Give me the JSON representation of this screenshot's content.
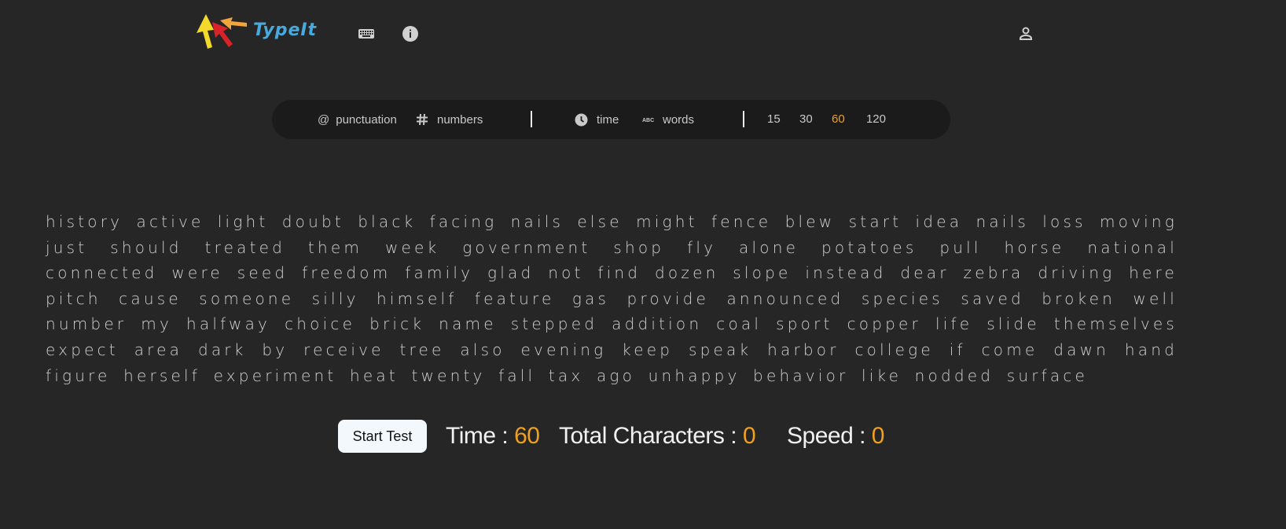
{
  "header": {
    "logo_text": "TypeIt",
    "icons": {
      "keyboard": "keyboard-icon",
      "info": "info-icon",
      "user": "user-icon"
    }
  },
  "config_bar": {
    "punctuation_symbol": "@",
    "punctuation_label": "punctuation",
    "numbers_label": "numbers",
    "time_label": "time",
    "words_label": "words",
    "durations": [
      "15",
      "30",
      "60",
      "120"
    ],
    "selected_duration": "60",
    "accent_color": "#f0a020"
  },
  "words_text": "history active light doubt black facing nails else might fence blew start idea nails loss moving just should treated them week government shop fly alone potatoes pull horse national connected were seed freedom family glad not find dozen slope instead dear zebra driving here pitch cause someone silly himself feature gas provide announced species saved broken well number my halfway choice brick name stepped addition coal sport copper life slide themselves expect area dark by receive tree also evening keep speak harbor college if come dawn hand figure herself experiment heat twenty fall tax ago unhappy behavior like nodded surface",
  "controls": {
    "start_button": "Start Test",
    "time_label": "Time : ",
    "time_value": "60",
    "chars_label": "Total Characters : ",
    "chars_value": "0",
    "speed_label": "Speed : ",
    "speed_value": "0"
  }
}
